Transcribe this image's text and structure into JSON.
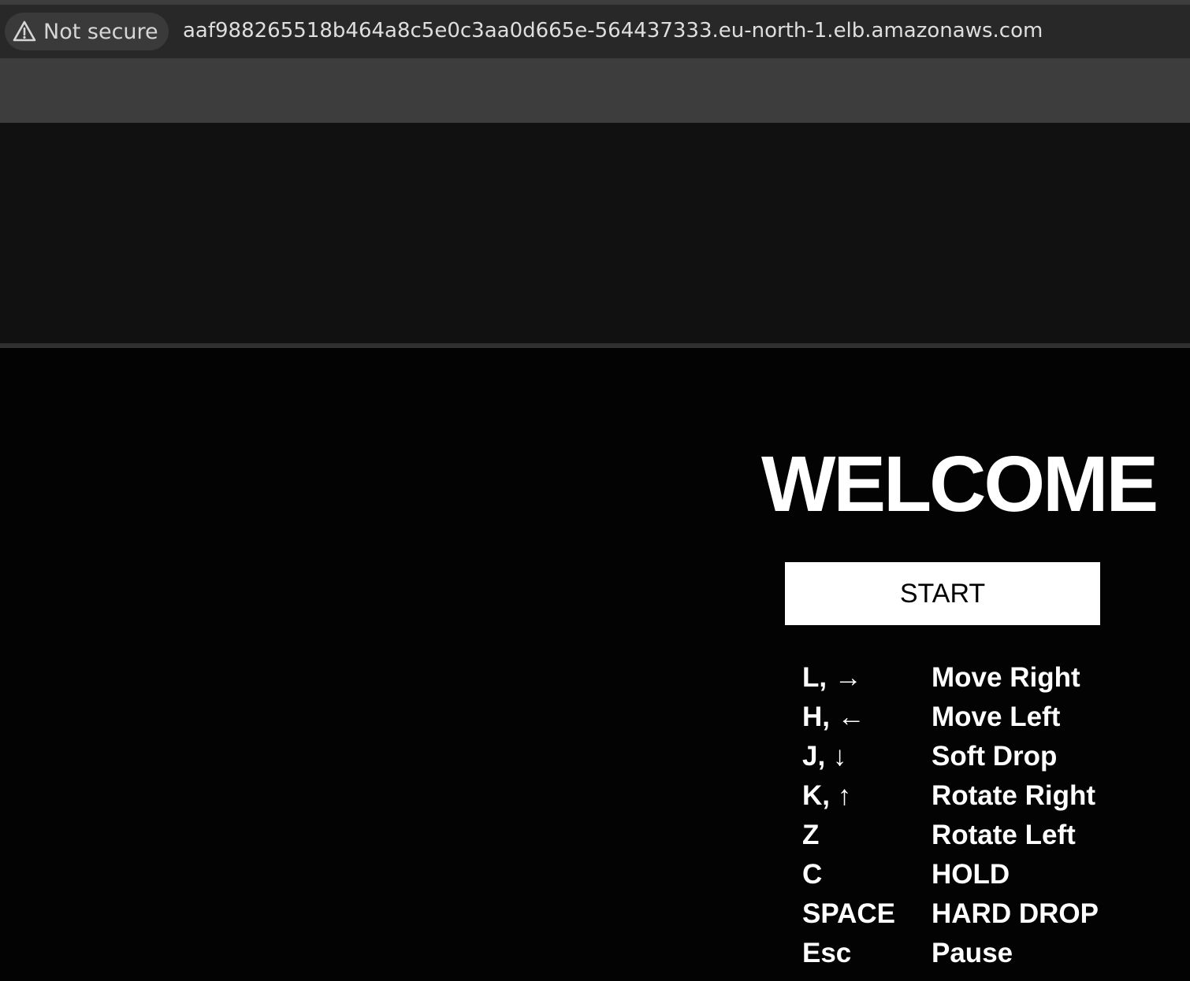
{
  "browser": {
    "security_label": "Not secure",
    "url": "aaf988265518b464a8c5e0c3aa0d665e-564437333.eu-north-1.elb.amazonaws.com"
  },
  "game": {
    "title": "WELCOME",
    "start_label": "START",
    "controls": [
      {
        "key": "L, →",
        "action": "Move Right"
      },
      {
        "key": "H, ←",
        "action": "Move Left"
      },
      {
        "key": "J, ↓",
        "action": "Soft Drop"
      },
      {
        "key": "K, ↑",
        "action": "Rotate Right"
      },
      {
        "key": "Z",
        "action": "Rotate Left"
      },
      {
        "key": "C",
        "action": "HOLD"
      },
      {
        "key": "SPACE",
        "action": "HARD DROP"
      },
      {
        "key": "Esc",
        "action": "Pause"
      }
    ]
  },
  "icons": {
    "security": "warning-triangle-icon"
  },
  "colors": {
    "browser_bar": "#3d3d3d",
    "address_bar": "#282828",
    "header_band": "#111111",
    "game_background": "#030303",
    "text": "#ffffff",
    "button_background": "#ffffff"
  }
}
